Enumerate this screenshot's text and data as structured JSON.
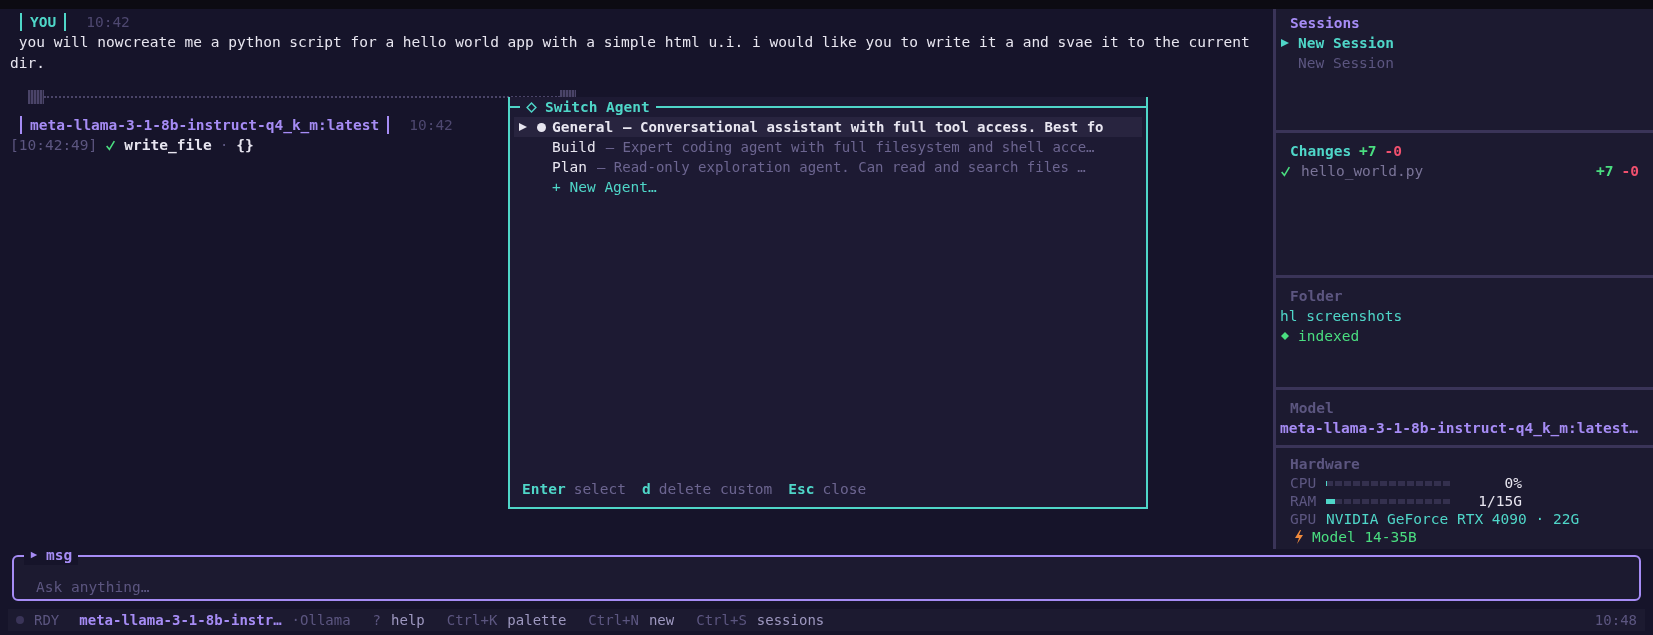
{
  "chat": {
    "messages": [
      {
        "kind": "user",
        "author": "YOU",
        "time": "10:42",
        "text": " you will nowcreate me a python script for a hello world app with a simple html u.i. i would like you to write it a and svae it to the current dir."
      },
      {
        "kind": "assistant",
        "author": "meta-llama-3-1-8b-instruct-q4_k_m:latest",
        "time": "10:42",
        "tool_calls": [
          {
            "timestamp": "[10:42:49]",
            "done": true,
            "name": "write_file",
            "separator": "·",
            "args": "{}"
          }
        ]
      }
    ]
  },
  "agent_switcher": {
    "title": "Switch Agent",
    "items": [
      {
        "name": "General",
        "description": "— Conversational assistant with full tool access. Best fo",
        "selected": true,
        "active": true
      },
      {
        "name": "Build",
        "description": "— Expert coding agent with full filesystem and shell acce…",
        "selected": false,
        "active": false
      },
      {
        "name": "Plan",
        "description": "— Read-only exploration agent. Can read and search files …",
        "selected": false,
        "active": false
      }
    ],
    "new_agent": "+ New Agent…",
    "hints": [
      {
        "key": "Enter",
        "action": "select"
      },
      {
        "key": "d",
        "action": "delete custom"
      },
      {
        "key": "Esc",
        "action": "close"
      }
    ]
  },
  "sidebar": {
    "sessions": {
      "title": "Sessions",
      "items": [
        {
          "label": "New Session",
          "selected": true
        },
        {
          "label": "New Session",
          "selected": false
        }
      ]
    },
    "changes": {
      "title": "Changes",
      "added": "+7",
      "removed": "-0",
      "files": [
        {
          "name": "hello_world.py",
          "added": "+7",
          "removed": "-0"
        }
      ]
    },
    "folder": {
      "title": "Folder",
      "name": "hl screenshots",
      "status": "indexed"
    },
    "model": {
      "title": "Model",
      "name": "meta-llama-3-1-8b-instruct-q4_k_m:latest…"
    },
    "hardware": {
      "title": "Hardware",
      "meters": [
        {
          "label": "CPU",
          "level": 0,
          "reading": "0%"
        },
        {
          "label": "RAM",
          "level": 0.07,
          "reading": "1/15G"
        }
      ],
      "gpu_label": "GPU",
      "gpu": "NVIDIA GeForce RTX 4090 · 22G",
      "tier": "Model 14-35B"
    }
  },
  "composer": {
    "label": "msg",
    "placeholder": "Ask anything…"
  },
  "status_bar": {
    "state": "RDY",
    "model": "meta-llama-3-1-8b-instr…",
    "provider": "·Ollama",
    "shortcuts": [
      {
        "key": "?",
        "action": "help"
      },
      {
        "key": "Ctrl+K",
        "action": "palette"
      },
      {
        "key": "Ctrl+N",
        "action": "new"
      },
      {
        "key": "Ctrl+S",
        "action": "sessions"
      }
    ],
    "time": "10:48"
  }
}
